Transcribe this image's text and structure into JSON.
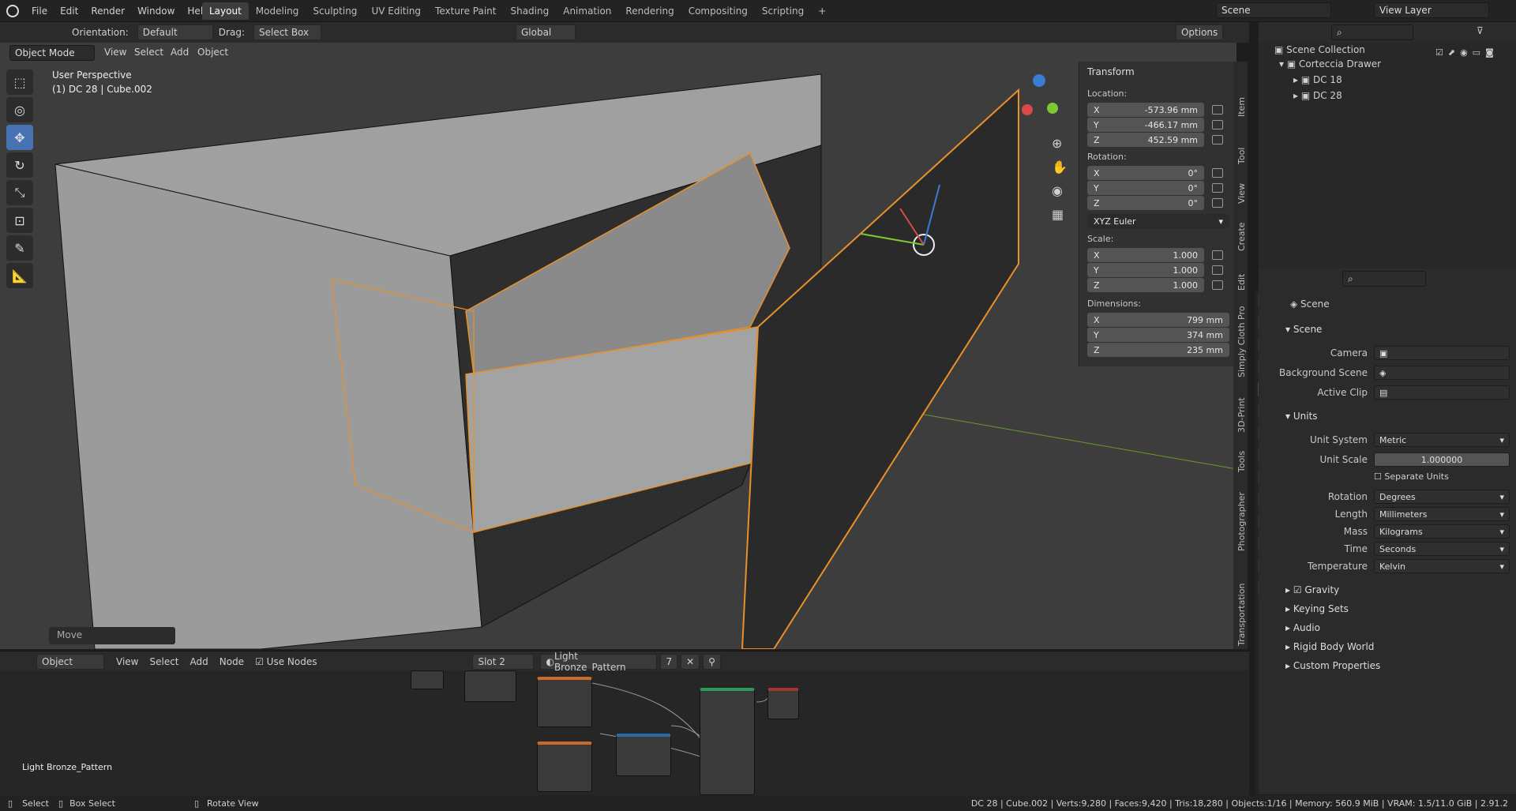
{
  "top_menu": [
    "File",
    "Edit",
    "Render",
    "Window",
    "Help"
  ],
  "workspaces": [
    "Layout",
    "Modeling",
    "Sculpting",
    "UV Editing",
    "Texture Paint",
    "Shading",
    "Animation",
    "Rendering",
    "Compositing",
    "Scripting"
  ],
  "active_workspace": "Layout",
  "add_tab": "+",
  "scene_name": "Scene",
  "view_layer": "View Layer",
  "tool_header": {
    "orientation_label": "Orientation:",
    "orientation_value": "Default",
    "drag_label": "Drag:",
    "drag_value": "Select Box",
    "transform_space": "Global",
    "options": "Options"
  },
  "viewport_header": {
    "mode": "Object Mode",
    "menus": [
      "View",
      "Select",
      "Add",
      "Object"
    ]
  },
  "viewport_info": {
    "perspective": "User Perspective",
    "object": "(1) DC 28 | Cube.002"
  },
  "last_op": "Move",
  "transform_panel": {
    "title": "Transform",
    "location_label": "Location:",
    "location": [
      {
        "axis": "X",
        "value": "-573.96 mm"
      },
      {
        "axis": "Y",
        "value": "-466.17 mm"
      },
      {
        "axis": "Z",
        "value": "452.59 mm"
      }
    ],
    "rotation_label": "Rotation:",
    "rotation": [
      {
        "axis": "X",
        "value": "0°"
      },
      {
        "axis": "Y",
        "value": "0°"
      },
      {
        "axis": "Z",
        "value": "0°"
      }
    ],
    "rotation_mode": "XYZ Euler",
    "scale_label": "Scale:",
    "scale": [
      {
        "axis": "X",
        "value": "1.000"
      },
      {
        "axis": "Y",
        "value": "1.000"
      },
      {
        "axis": "Z",
        "value": "1.000"
      }
    ],
    "dimensions_label": "Dimensions:",
    "dimensions": [
      {
        "axis": "X",
        "value": "799 mm"
      },
      {
        "axis": "Y",
        "value": "374 mm"
      },
      {
        "axis": "Z",
        "value": "235 mm"
      }
    ]
  },
  "side_tabs": [
    "Item",
    "Tool",
    "View",
    "Create",
    "Edit",
    "Simply Cloth Pro",
    "3D-Print",
    "Tools",
    "Photographer",
    "Transportation"
  ],
  "outliner": {
    "root": "Scene Collection",
    "collection": "Corteccia Drawer",
    "items": [
      "DC 18",
      "DC 28"
    ]
  },
  "properties": {
    "header": "Scene",
    "scene_section": "Scene",
    "camera_label": "Camera",
    "background_label": "Background Scene",
    "clip_label": "Active Clip",
    "units_section": "Units",
    "unit_system_label": "Unit System",
    "unit_system": "Metric",
    "unit_scale_label": "Unit Scale",
    "unit_scale": "1.000000",
    "separate_units": "Separate Units",
    "rotation_label": "Rotation",
    "rotation": "Degrees",
    "length_label": "Length",
    "length": "Millimeters",
    "mass_label": "Mass",
    "mass": "Kilograms",
    "time_label": "Time",
    "time": "Seconds",
    "temperature_label": "Temperature",
    "temperature": "Kelvin",
    "collapsed": [
      "Gravity",
      "Keying Sets",
      "Audio",
      "Rigid Body World",
      "Custom Properties"
    ]
  },
  "node_header": {
    "type": "Object",
    "menus": [
      "View",
      "Select",
      "Add",
      "Node"
    ],
    "use_nodes": "Use Nodes",
    "slot": "Slot 2",
    "material": "Light Bronze_Pattern",
    "users": "7"
  },
  "node_material_label": "Light Bronze_Pattern",
  "statusbar": {
    "select": "Select",
    "box_select": "Box Select",
    "rotate": "Rotate View",
    "stats": "DC 28 | Cube.002 | Verts:9,280 | Faces:9,420 | Tris:18,280 | Objects:1/16 | Memory: 560.9 MiB | VRAM: 1.5/11.0 GiB | 2.91.2"
  },
  "colors": {
    "accent": "#4772b3",
    "selection": "#e8902a",
    "grid_green": "#6a9a2a"
  }
}
